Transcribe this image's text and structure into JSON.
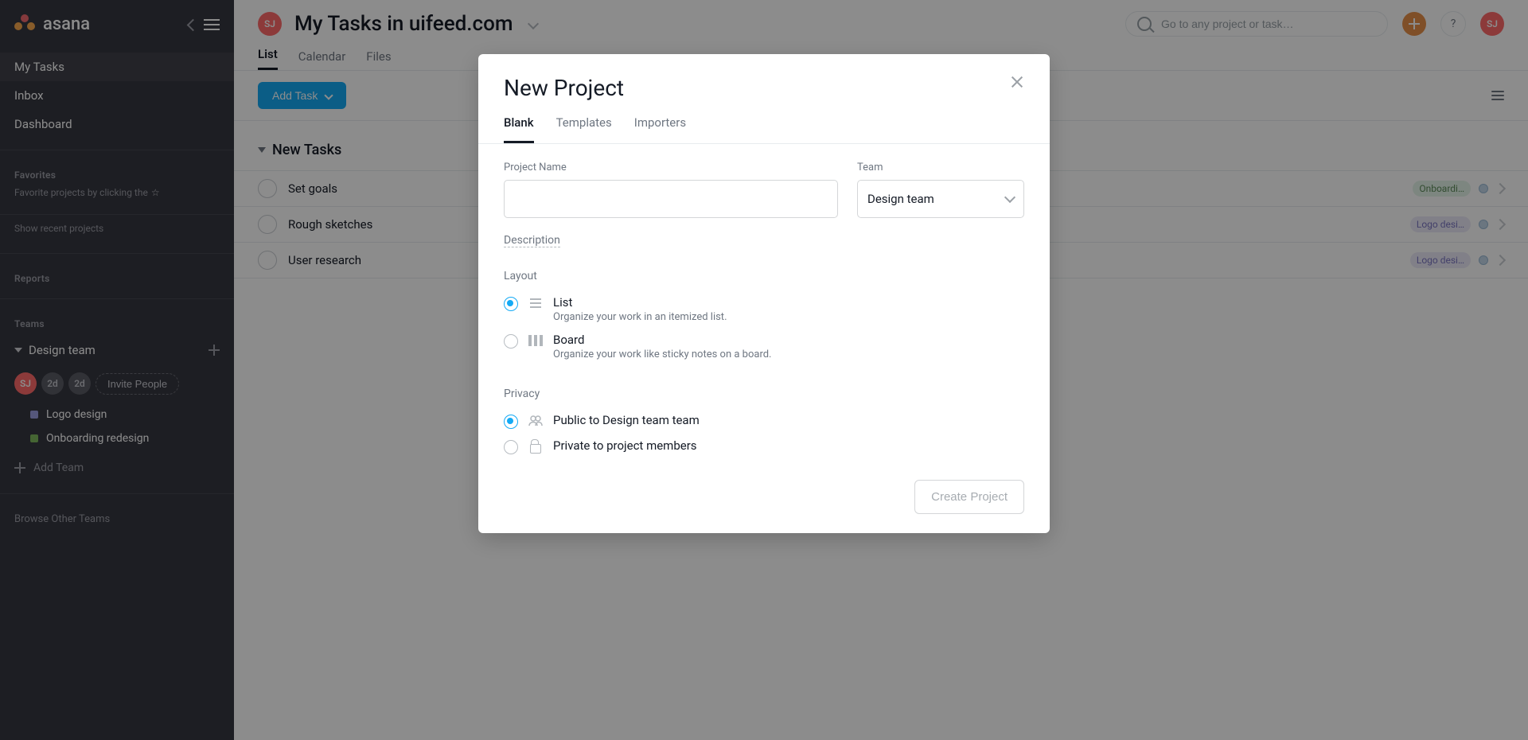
{
  "colors": {
    "accent_blue": "#14aaf5",
    "accent_orange": "#e8914a"
  },
  "sidebar": {
    "logo_text": "asana",
    "nav": [
      {
        "key": "my-tasks",
        "label": "My Tasks",
        "active": true
      },
      {
        "key": "inbox",
        "label": "Inbox",
        "active": false
      },
      {
        "key": "dashboard",
        "label": "Dashboard",
        "active": false
      }
    ],
    "favorites": {
      "title": "Favorites",
      "hint_prefix": "Favorite projects by clicking the",
      "hint_star": "☆"
    },
    "recent_link": "Show recent projects",
    "reports": {
      "title": "Reports"
    },
    "teams": {
      "title": "Teams",
      "items": [
        {
          "name": "Design team",
          "members": [
            {
              "initials": "SJ",
              "class": "sj"
            },
            {
              "initials": "2d",
              "class": "dim1"
            },
            {
              "initials": "2d",
              "class": "dim2"
            }
          ],
          "invite_label": "Invite People",
          "projects": [
            {
              "name": "Logo design",
              "color": "purple"
            },
            {
              "name": "Onboarding redesign",
              "color": "green"
            }
          ]
        }
      ]
    },
    "add_team": "Add Team",
    "browse_other": "Browse Other Teams"
  },
  "header": {
    "user_initials": "SJ",
    "title": "My Tasks in uifeed.com",
    "search_placeholder": "Go to any project or task…",
    "tabs": [
      {
        "key": "list",
        "label": "List",
        "active": true
      },
      {
        "key": "calendar",
        "label": "Calendar",
        "active": false
      },
      {
        "key": "files",
        "label": "Files",
        "active": false
      }
    ]
  },
  "toolbar": {
    "add_task_label": "Add Task"
  },
  "task_groups": [
    {
      "title": "New Tasks",
      "tasks": [
        {
          "name": "Set goals",
          "project": "Onboardi…",
          "project_color": "green"
        },
        {
          "name": "Rough sketches",
          "project": "Logo desi…",
          "project_color": "purple"
        },
        {
          "name": "User research",
          "project": "Logo desi…",
          "project_color": "purple"
        }
      ]
    }
  ],
  "modal": {
    "title": "New Project",
    "tabs": [
      {
        "key": "blank",
        "label": "Blank",
        "active": true
      },
      {
        "key": "templates",
        "label": "Templates",
        "active": false
      },
      {
        "key": "importers",
        "label": "Importers",
        "active": false
      }
    ],
    "project_name_label": "Project Name",
    "project_name_value": "",
    "team_label": "Team",
    "team_selected": "Design team",
    "description_label": "Description",
    "layout": {
      "title": "Layout",
      "options": [
        {
          "key": "list",
          "title": "List",
          "sub": "Organize your work in an itemized list.",
          "checked": true,
          "icon": "list"
        },
        {
          "key": "board",
          "title": "Board",
          "sub": "Organize your work like sticky notes on a board.",
          "checked": false,
          "icon": "board"
        }
      ]
    },
    "privacy": {
      "title": "Privacy",
      "options": [
        {
          "key": "public",
          "title": "Public to Design team team",
          "checked": true,
          "icon": "people"
        },
        {
          "key": "private",
          "title": "Private to project members",
          "checked": false,
          "icon": "lock"
        }
      ]
    },
    "create_label": "Create Project"
  }
}
